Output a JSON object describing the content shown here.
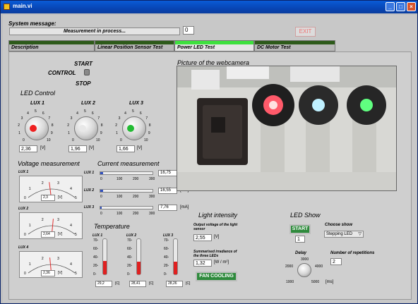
{
  "window": {
    "title": "main.vi"
  },
  "system": {
    "label": "System message:",
    "message": "Measurement in process...",
    "counter": "0",
    "exit_label": "EXIT"
  },
  "tabs": [
    {
      "label": "Description"
    },
    {
      "label": "Linear Position Sensor Test"
    },
    {
      "label": "Power LED Test"
    },
    {
      "label": "DC Motor Test"
    }
  ],
  "control": {
    "label": "CONTROL",
    "start": "START",
    "stop": "STOP"
  },
  "led_control": {
    "title": "LED Control",
    "knobs": [
      {
        "label": "LUX 1",
        "value": "2,36",
        "unit": "[V]",
        "led_color": "#ee2020"
      },
      {
        "label": "LUX 2",
        "value": "1,96",
        "unit": "[V]",
        "led_color": "#e8e8e8"
      },
      {
        "label": "LUX 3",
        "value": "1,66",
        "unit": "[V]",
        "led_color": "#22bb33"
      }
    ],
    "scale": [
      "0",
      "1",
      "2",
      "3",
      "4",
      "5",
      "6",
      "7",
      "8",
      "9",
      "10"
    ]
  },
  "voltage": {
    "title": "Voltage measurement",
    "gauges": [
      {
        "label": "LUX 1",
        "value": "2,3",
        "unit": "[V]",
        "level": 0.46
      },
      {
        "label": "LUX 2",
        "value": "2,64",
        "unit": "[V]",
        "level": 0.53
      },
      {
        "label": "LUX 4",
        "value": "2,36",
        "unit": "[V]",
        "level": 0.47
      }
    ],
    "scale": [
      "0",
      "1",
      "2",
      "3",
      "4",
      "5"
    ]
  },
  "current": {
    "title": "Current measurement",
    "rows": [
      {
        "label": "LUX 1",
        "value": "16,75",
        "unit": "[mA]",
        "level": 0.06
      },
      {
        "label": "LUX 2",
        "value": "16,55",
        "unit": "[mA]",
        "level": 0.06
      },
      {
        "label": "LUX 3",
        "value": "7,76",
        "unit": "[mA]",
        "level": 0.03
      }
    ],
    "scale": [
      "0",
      "100",
      "200",
      "300"
    ]
  },
  "temperature": {
    "title": "Temperature",
    "items": [
      {
        "label": "LUX 1",
        "value": "29,2",
        "unit": "[C]",
        "level": 0.38
      },
      {
        "label": "LUX 2",
        "value": "28,41",
        "unit": "[C]",
        "level": 0.37
      },
      {
        "label": "LUX 3",
        "value": "28,26",
        "unit": "[C]",
        "level": 0.36
      }
    ],
    "scale": [
      "70-",
      "60-",
      "40-",
      "20-",
      "0-"
    ]
  },
  "camera": {
    "title": "Picture of the webcamera"
  },
  "intensity": {
    "title": "Light intensity",
    "voltage_label": "Output voltage of the light sensor",
    "voltage_value": "2,55",
    "voltage_unit": "[V]",
    "irr_label": "Summarised irradiance of the three LEDs",
    "irr_value": "1,32",
    "irr_unit": "[W / m²]",
    "fan_label": "FAN COOLING"
  },
  "ledshow": {
    "title": "LED Show",
    "start": "START",
    "start_count": "1",
    "choose_label": "Choose show",
    "choose_value": "Stepping LED",
    "delay_label": "Delay",
    "delay_ticks": [
      "3000",
      "2000",
      "4000",
      "1000",
      "5000"
    ],
    "delay_unit": "[ms]",
    "rep_label": "Number of repetitions",
    "rep_value": "2"
  }
}
